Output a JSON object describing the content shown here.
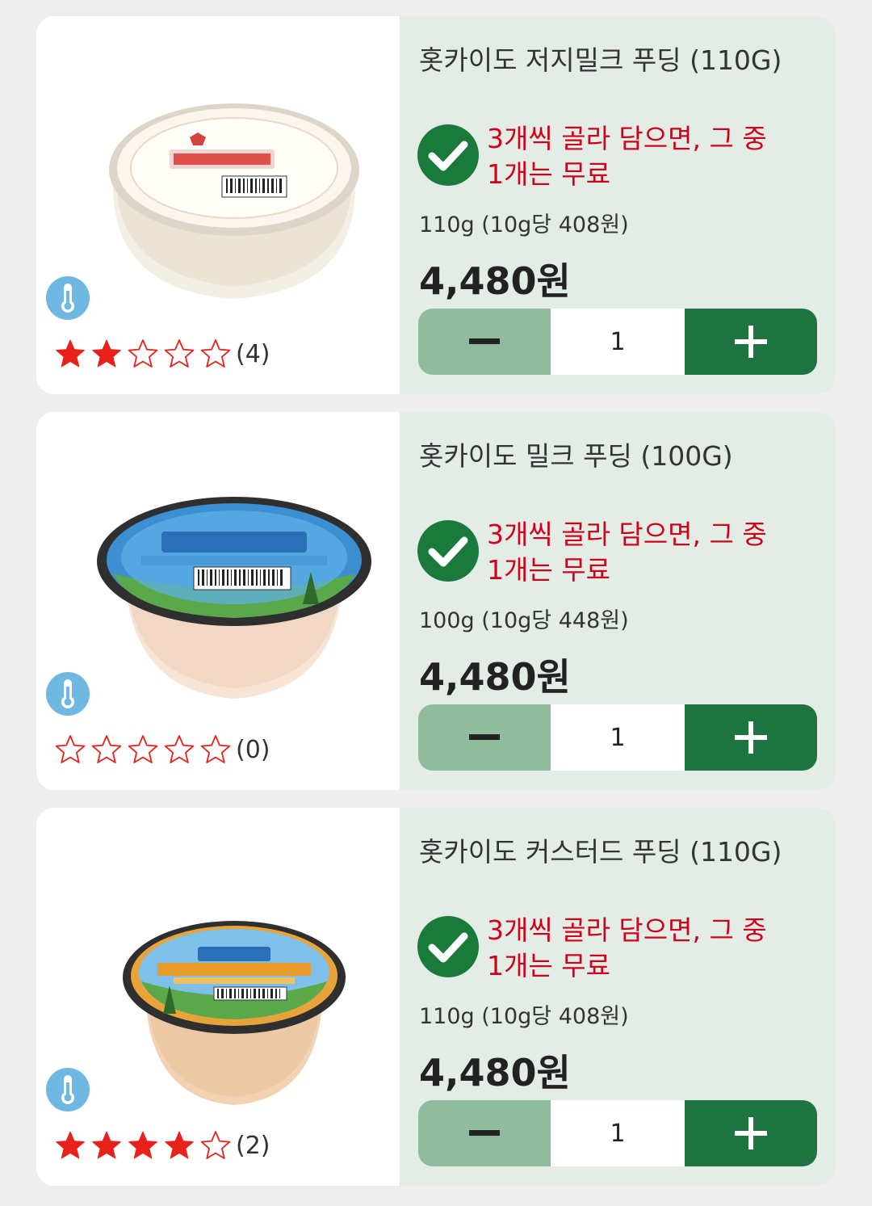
{
  "colors": {
    "accent_green": "#1f7542",
    "minus_green": "#8fbc9c",
    "panel_bg": "#e3ede6",
    "promo_red": "#d0021b",
    "star_red": "#e8221a"
  },
  "products": [
    {
      "title": "홋카이도 저지밀크 푸딩 (110G)",
      "promo_line1": "3개씩 골라 담으면, 그 중",
      "promo_line2": "1개는 무료",
      "unit_price": "110g (10g당 408원)",
      "price": "4,480원",
      "quantity": "1",
      "rating_filled": 2,
      "review_count": "(4)",
      "image_icon": "jersey-milk-pudding-cup",
      "storage_icon": "thermometer-icon"
    },
    {
      "title": "홋카이도 밀크 푸딩 (100G)",
      "promo_line1": "3개씩 골라 담으면, 그 중",
      "promo_line2": "1개는 무료",
      "unit_price": "100g (10g당 448원)",
      "price": "4,480원",
      "quantity": "1",
      "rating_filled": 0,
      "review_count": "(0)",
      "image_icon": "milk-pudding-cup",
      "storage_icon": "thermometer-icon"
    },
    {
      "title": "홋카이도 커스터드 푸딩 (110G)",
      "promo_line1": "3개씩 골라 담으면, 그 중",
      "promo_line2": "1개는 무료",
      "unit_price": "110g (10g당 408원)",
      "price": "4,480원",
      "quantity": "1",
      "rating_filled": 4,
      "review_count": "(2)",
      "image_icon": "custard-pudding-cup",
      "storage_icon": "thermometer-icon"
    }
  ]
}
